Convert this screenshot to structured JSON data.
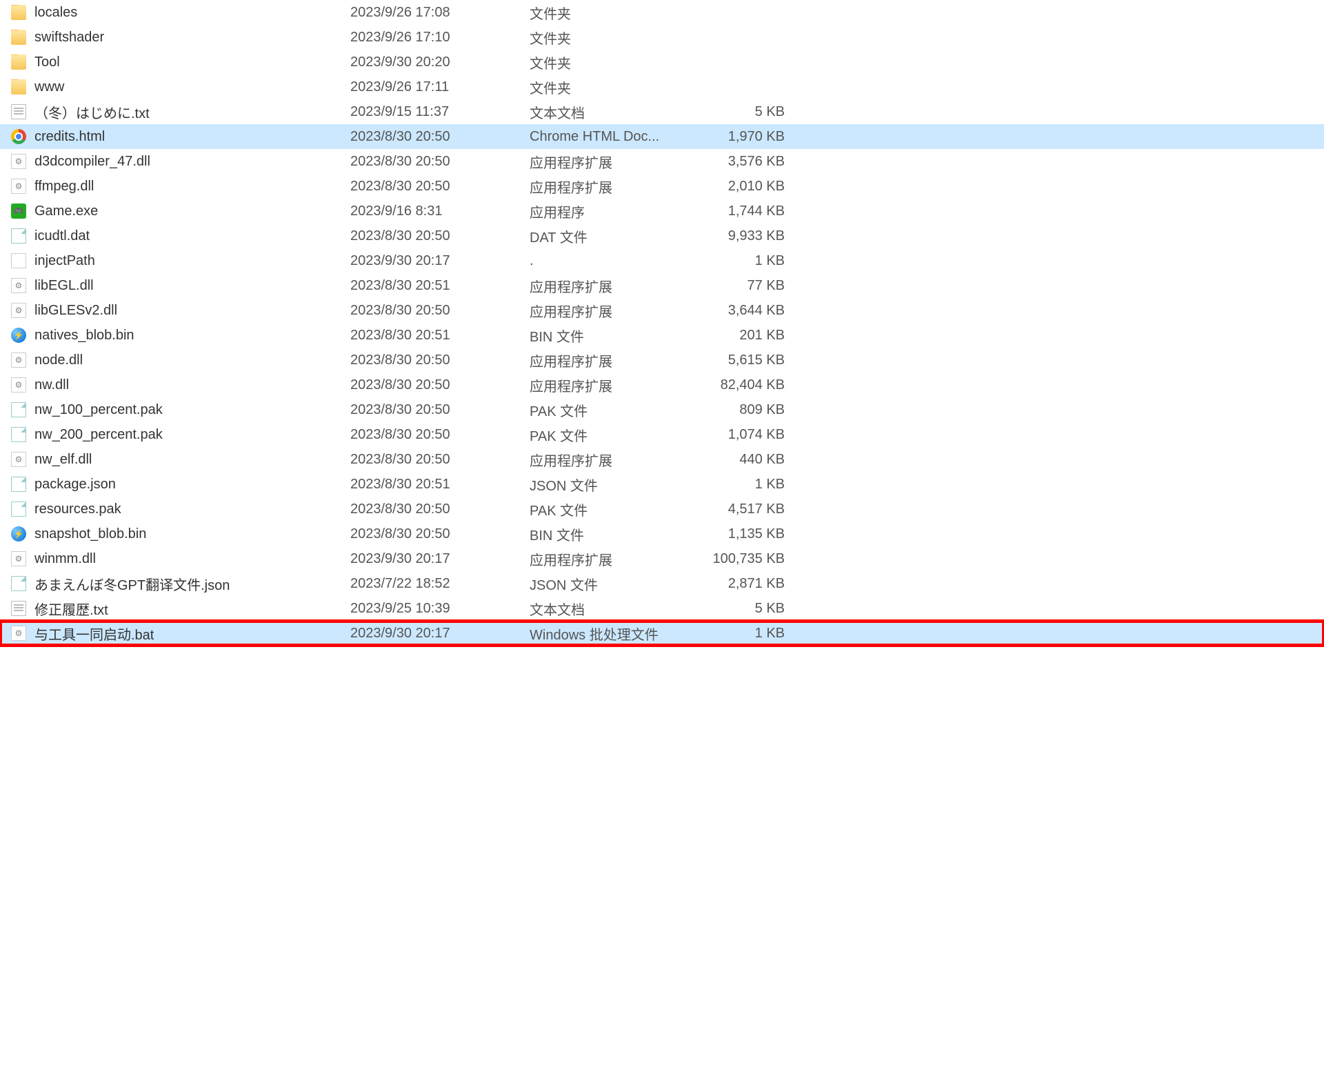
{
  "files": [
    {
      "icon": "folder",
      "name": "locales",
      "date": "2023/9/26 17:08",
      "type": "文件夹",
      "size": ""
    },
    {
      "icon": "folder",
      "name": "swiftshader",
      "date": "2023/9/26 17:10",
      "type": "文件夹",
      "size": ""
    },
    {
      "icon": "folder",
      "name": "Tool",
      "date": "2023/9/30 20:20",
      "type": "文件夹",
      "size": ""
    },
    {
      "icon": "folder",
      "name": "www",
      "date": "2023/9/26 17:11",
      "type": "文件夹",
      "size": ""
    },
    {
      "icon": "txt",
      "name": "（冬）はじめに.txt",
      "date": "2023/9/15 11:37",
      "type": "文本文档",
      "size": "5 KB"
    },
    {
      "icon": "chrome",
      "name": "credits.html",
      "date": "2023/8/30 20:50",
      "type": "Chrome HTML Doc...",
      "size": "1,970 KB",
      "selected": true
    },
    {
      "icon": "dll",
      "name": "d3dcompiler_47.dll",
      "date": "2023/8/30 20:50",
      "type": "应用程序扩展",
      "size": "3,576 KB"
    },
    {
      "icon": "dll",
      "name": "ffmpeg.dll",
      "date": "2023/8/30 20:50",
      "type": "应用程序扩展",
      "size": "2,010 KB"
    },
    {
      "icon": "exe",
      "name": "Game.exe",
      "date": "2023/9/16 8:31",
      "type": "应用程序",
      "size": "1,744 KB"
    },
    {
      "icon": "file",
      "name": "icudtl.dat",
      "date": "2023/8/30 20:50",
      "type": "DAT 文件",
      "size": "9,933 KB"
    },
    {
      "icon": "blank",
      "name": "injectPath",
      "date": "2023/9/30 20:17",
      "type": ".",
      "size": "1 KB"
    },
    {
      "icon": "dll",
      "name": "libEGL.dll",
      "date": "2023/8/30 20:51",
      "type": "应用程序扩展",
      "size": "77 KB"
    },
    {
      "icon": "dll",
      "name": "libGLESv2.dll",
      "date": "2023/8/30 20:50",
      "type": "应用程序扩展",
      "size": "3,644 KB"
    },
    {
      "icon": "bin",
      "name": "natives_blob.bin",
      "date": "2023/8/30 20:51",
      "type": "BIN 文件",
      "size": "201 KB"
    },
    {
      "icon": "dll",
      "name": "node.dll",
      "date": "2023/8/30 20:50",
      "type": "应用程序扩展",
      "size": "5,615 KB"
    },
    {
      "icon": "dll",
      "name": "nw.dll",
      "date": "2023/8/30 20:50",
      "type": "应用程序扩展",
      "size": "82,404 KB"
    },
    {
      "icon": "file",
      "name": "nw_100_percent.pak",
      "date": "2023/8/30 20:50",
      "type": "PAK 文件",
      "size": "809 KB"
    },
    {
      "icon": "file",
      "name": "nw_200_percent.pak",
      "date": "2023/8/30 20:50",
      "type": "PAK 文件",
      "size": "1,074 KB"
    },
    {
      "icon": "dll",
      "name": "nw_elf.dll",
      "date": "2023/8/30 20:50",
      "type": "应用程序扩展",
      "size": "440 KB"
    },
    {
      "icon": "file",
      "name": "package.json",
      "date": "2023/8/30 20:51",
      "type": "JSON 文件",
      "size": "1 KB"
    },
    {
      "icon": "file",
      "name": "resources.pak",
      "date": "2023/8/30 20:50",
      "type": "PAK 文件",
      "size": "4,517 KB"
    },
    {
      "icon": "bin",
      "name": "snapshot_blob.bin",
      "date": "2023/8/30 20:50",
      "type": "BIN 文件",
      "size": "1,135 KB"
    },
    {
      "icon": "dll",
      "name": "winmm.dll",
      "date": "2023/9/30 20:17",
      "type": "应用程序扩展",
      "size": "100,735 KB"
    },
    {
      "icon": "file",
      "name": "あまえんぼ冬GPT翻译文件.json",
      "date": "2023/7/22 18:52",
      "type": "JSON 文件",
      "size": "2,871 KB"
    },
    {
      "icon": "txt",
      "name": "修正履歴.txt",
      "date": "2023/9/25 10:39",
      "type": "文本文档",
      "size": "5 KB"
    },
    {
      "icon": "dll",
      "name": "与工具一同启动.bat",
      "date": "2023/9/30 20:17",
      "type": "Windows 批处理文件",
      "size": "1 KB",
      "highlighted": true
    }
  ]
}
